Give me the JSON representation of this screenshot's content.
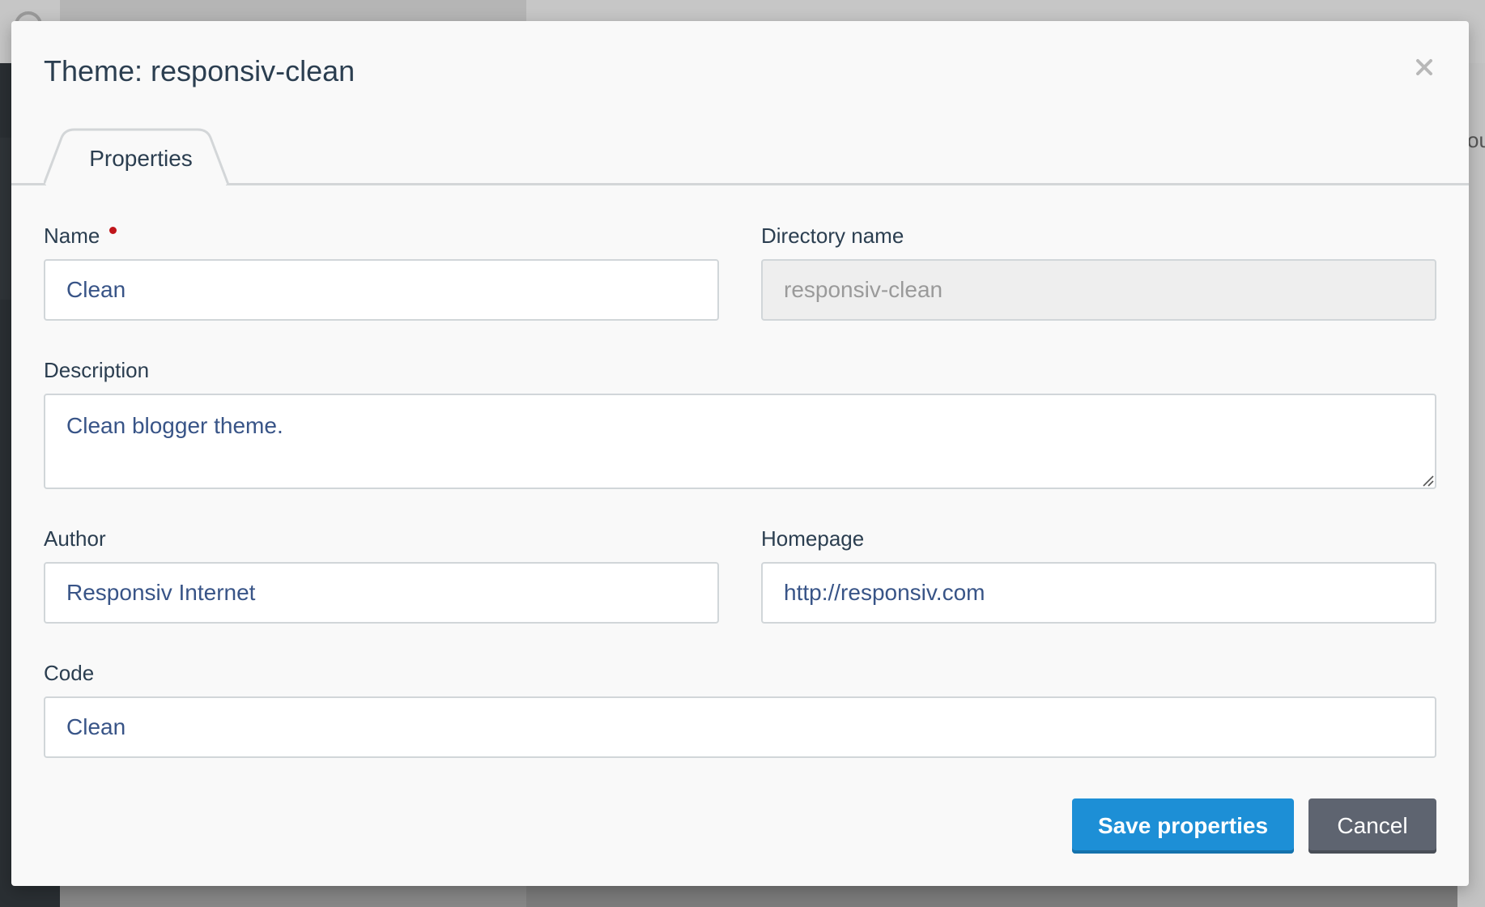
{
  "modal": {
    "title": "Theme: responsiv-clean"
  },
  "tabs": [
    {
      "label": "Properties"
    }
  ],
  "form": {
    "name": {
      "label": "Name",
      "value": "Clean",
      "required": true
    },
    "directory_name": {
      "label": "Directory name",
      "value": "responsiv-clean",
      "disabled": true
    },
    "description": {
      "label": "Description",
      "value": "Clean blogger theme."
    },
    "author": {
      "label": "Author",
      "value": "Responsiv Internet"
    },
    "homepage": {
      "label": "Homepage",
      "value": "http://responsiv.com"
    },
    "code": {
      "label": "Code",
      "value": "Clean"
    }
  },
  "buttons": {
    "save_label": "Save properties",
    "cancel_label": "Cancel"
  },
  "background": {
    "partial_text": "ou"
  },
  "colors": {
    "primary": "#1d8fd6",
    "secondary": "#5e6470",
    "required": "#c0161b",
    "text": "#2b3e50",
    "input_text": "#385487"
  },
  "icons": {
    "close": "close-icon",
    "required": "required-dot-icon",
    "resize": "resize-grip-icon"
  }
}
